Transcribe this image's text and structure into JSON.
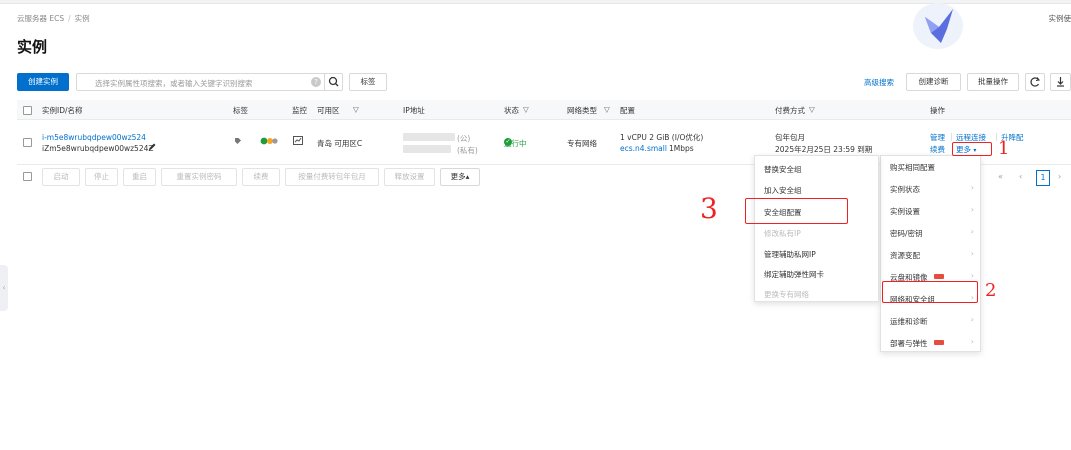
{
  "breadcrumb": {
    "root": "云服务器 ECS",
    "current": "实例"
  },
  "title": "实例",
  "top_right_text": "实例使",
  "toolbar": {
    "create_label": "创建实例",
    "search_placeholder": "选择实例属性项搜索，或者输入关键字识别搜索",
    "tag_label": "标签",
    "advanced_search": "高级搜索",
    "create_diagnosis": "创建诊断",
    "batch_ops": "批量操作"
  },
  "table": {
    "headers": {
      "id_name": "实例ID/名称",
      "tags": "标签",
      "monitor": "监控",
      "zone": "可用区",
      "ip": "IP地址",
      "status": "状态",
      "net_type": "网络类型",
      "config": "配置",
      "billing": "付费方式",
      "ops": "操作"
    },
    "row": {
      "id": "i-m5e8wrubqdpew00wz524",
      "name": "iZm5e8wrubqdpew00wz524Z",
      "zone": "青岛 可用区C",
      "ip_public_suffix": "(公)",
      "ip_private_suffix": "(私有)",
      "status": "运行中",
      "net_type": "专有网络",
      "config_line1": "1 vCPU 2 GiB   (I/O优化)",
      "config_spec": "ecs.n4.small",
      "config_bw": "1Mbps",
      "billing_type": "包年包月",
      "billing_expire": "2025年2月25日 23:59 到期",
      "op_manage": "管理",
      "op_remote": "远程连接",
      "op_upgrade": "升降配",
      "op_renew": "续费",
      "op_more": "更多"
    }
  },
  "bottom_bar": [
    "启动",
    "停止",
    "重启",
    "重置实例密码",
    "续费",
    "按量付费转包年包月",
    "释放设置",
    "更多▴"
  ],
  "pager": {
    "first": "«",
    "prev": "‹",
    "page": "1",
    "next": "›"
  },
  "more_menu": [
    {
      "label": "购买相同配置",
      "arrow": false,
      "badge": false
    },
    {
      "label": "实例状态",
      "arrow": true,
      "badge": false
    },
    {
      "label": "实例设置",
      "arrow": true,
      "badge": false
    },
    {
      "label": "密码/密钥",
      "arrow": true,
      "badge": false
    },
    {
      "label": "资源变配",
      "arrow": true,
      "badge": false
    },
    {
      "label": "云盘和镜像",
      "arrow": true,
      "badge": true
    },
    {
      "label": "网络和安全组",
      "arrow": true,
      "badge": false
    },
    {
      "label": "运维和诊断",
      "arrow": true,
      "badge": false
    },
    {
      "label": "部署与弹性",
      "arrow": true,
      "badge": true
    }
  ],
  "sub_menu": [
    {
      "label": "替换安全组",
      "disabled": false
    },
    {
      "label": "加入安全组",
      "disabled": false
    },
    {
      "label": "安全组配置",
      "disabled": false
    },
    {
      "label": "修改私有IP",
      "disabled": true
    },
    {
      "label": "管理辅助私网IP",
      "disabled": false
    },
    {
      "label": "绑定辅助弹性网卡",
      "disabled": false
    },
    {
      "label": "更换专有网络",
      "disabled": true
    }
  ],
  "annotations": {
    "one": "1",
    "two": "2",
    "three": "3"
  },
  "colors": {
    "primary": "#0070cc",
    "annotation_red": "#e22222",
    "running_green": "#1f9d3a"
  }
}
